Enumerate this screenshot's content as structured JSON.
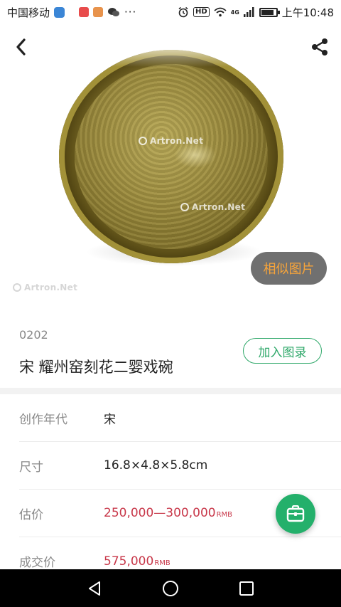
{
  "status_bar": {
    "carrier": "中国移动",
    "extra_indicator": "···",
    "network": "4G",
    "hd_badge": "HD",
    "time": "上午10:48",
    "battery_level": 0.85,
    "icons": [
      "shield-icon",
      "app-icon",
      "app-icon",
      "wechat-icon",
      "alarm-icon",
      "wifi-icon",
      "signal-icon",
      "battery-icon"
    ]
  },
  "header": {
    "back_icon": "chevron-left-icon",
    "share_icon": "share-icon"
  },
  "hero": {
    "watermark_text": "Artron.Net",
    "similar_label": "相似图片"
  },
  "lot": {
    "number": "0202",
    "title": "宋 耀州窑刻花二婴戏碗",
    "catalog_button": "加入图录"
  },
  "details": [
    {
      "label": "创作年代",
      "value": "宋",
      "unit": "",
      "highlight": false
    },
    {
      "label": "尺寸",
      "value": "16.8×4.8×5.8cm",
      "unit": "",
      "highlight": false
    },
    {
      "label": "估价",
      "value": "250,000—300,000",
      "unit": "RMB",
      "highlight": true
    },
    {
      "label": "成交价",
      "value": "575,000",
      "unit": "RMB",
      "highlight": true
    }
  ],
  "colors": {
    "accent_green": "#24b06b",
    "price_red": "#c8384a",
    "similar_orange": "#f7a43a"
  },
  "fab": {
    "icon": "briefcase-icon"
  },
  "nav_bar": {
    "icons": [
      "back-triangle-icon",
      "home-circle-icon",
      "recents-square-icon"
    ]
  }
}
